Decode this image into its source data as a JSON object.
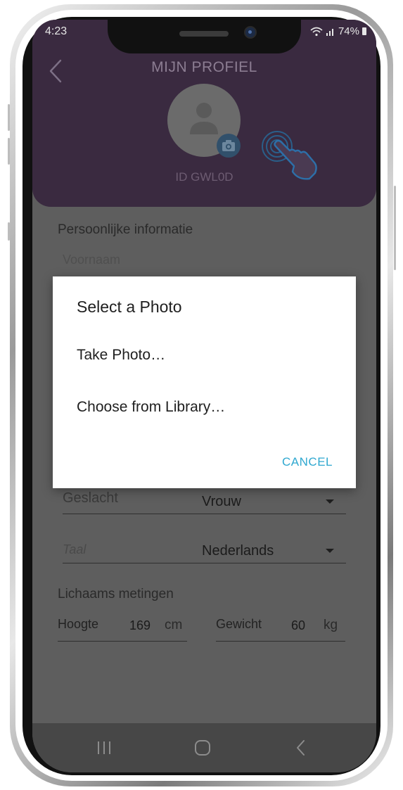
{
  "status_bar": {
    "time": "4:23",
    "battery": "74%"
  },
  "header": {
    "title": "MIJN PROFIEL",
    "user_id": "ID GWL0D"
  },
  "form": {
    "personal_section": "Persoonlijke informatie",
    "first_name_placeholder": "Voornaam",
    "gender_label": "Geslacht",
    "gender_value": "Vrouw",
    "language_label": "Taal",
    "language_value": "Nederlands",
    "measurements_section": "Lichaams metingen",
    "height_label": "Hoogte",
    "height_value": "169",
    "height_unit": "cm",
    "weight_label": "Gewicht",
    "weight_value": "60",
    "weight_unit": "kg"
  },
  "dialog": {
    "title": "Select a Photo",
    "options": [
      "Take Photo…",
      "Choose from Library…"
    ],
    "cancel": "CANCEL"
  },
  "icons": [
    "back-arrow-icon",
    "user-silhouette-icon",
    "camera-icon",
    "tap-hand-icon",
    "wifi-icon",
    "signal-icon",
    "battery-icon",
    "recent-apps-icon",
    "home-icon",
    "nav-back-icon"
  ],
  "colors": {
    "header_bg": "#3a2a40",
    "accent": "#2fa8d0",
    "overlay": "#5e5e5e"
  }
}
